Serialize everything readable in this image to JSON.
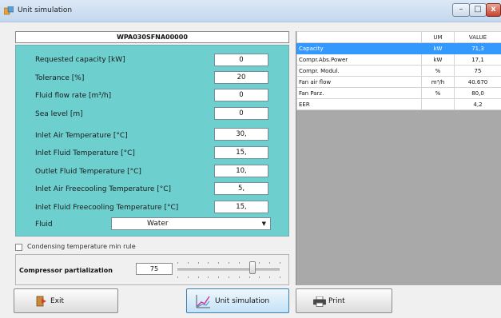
{
  "window": {
    "title": "Unit simulation",
    "minimize": "–",
    "maximize": "□",
    "close": "x"
  },
  "model": "WPA030SFNA00000",
  "params": [
    {
      "label": "Requested capacity [kW]",
      "value": "0"
    },
    {
      "label": "Tolerance [%]",
      "value": "20"
    },
    {
      "label": "Fluid flow rate [m³/h]",
      "value": "0"
    },
    {
      "label": "Sea level [m]",
      "value": "0"
    },
    {
      "label": "Inlet Air Temperature [°C]",
      "value": "30,"
    },
    {
      "label": "Inlet Fluid Temperature [°C]",
      "value": "15,"
    },
    {
      "label": "Outlet Fluid Temperature [°C]",
      "value": "10,"
    },
    {
      "label": "Inlet Air Freecooling Temperature [°C]",
      "value": "5,"
    },
    {
      "label": "Inlet Fluid Freecooling Temperature [°C]",
      "value": "15,"
    }
  ],
  "fluid": {
    "label": "Fluid",
    "value": "Water"
  },
  "condensing": {
    "label": "Condensing temperature min rule",
    "checked": false
  },
  "compressor": {
    "label": "Compressor partialization",
    "value": "75",
    "slider_fraction": 0.75
  },
  "results": {
    "headers": [
      "",
      "UM",
      "VALUE"
    ],
    "rows": [
      {
        "name": "Capacity",
        "um": "kW",
        "value": "71,3"
      },
      {
        "name": "Compr.Abs.Power",
        "um": "kW",
        "value": "17,1"
      },
      {
        "name": "Compr. Modul.",
        "um": "%",
        "value": "75"
      },
      {
        "name": "Fan air flow",
        "um": "m³/h",
        "value": "40.670"
      },
      {
        "name": "Fan Parz.",
        "um": "%",
        "value": "80,0"
      },
      {
        "name": "EER",
        "um": "",
        "value": "4,2"
      }
    ]
  },
  "buttons": {
    "exit": "Exit",
    "simulate": "Unit simulation",
    "print": "Print"
  },
  "colors": {
    "panel": "#6ecfcf",
    "selection": "#3399ff"
  }
}
